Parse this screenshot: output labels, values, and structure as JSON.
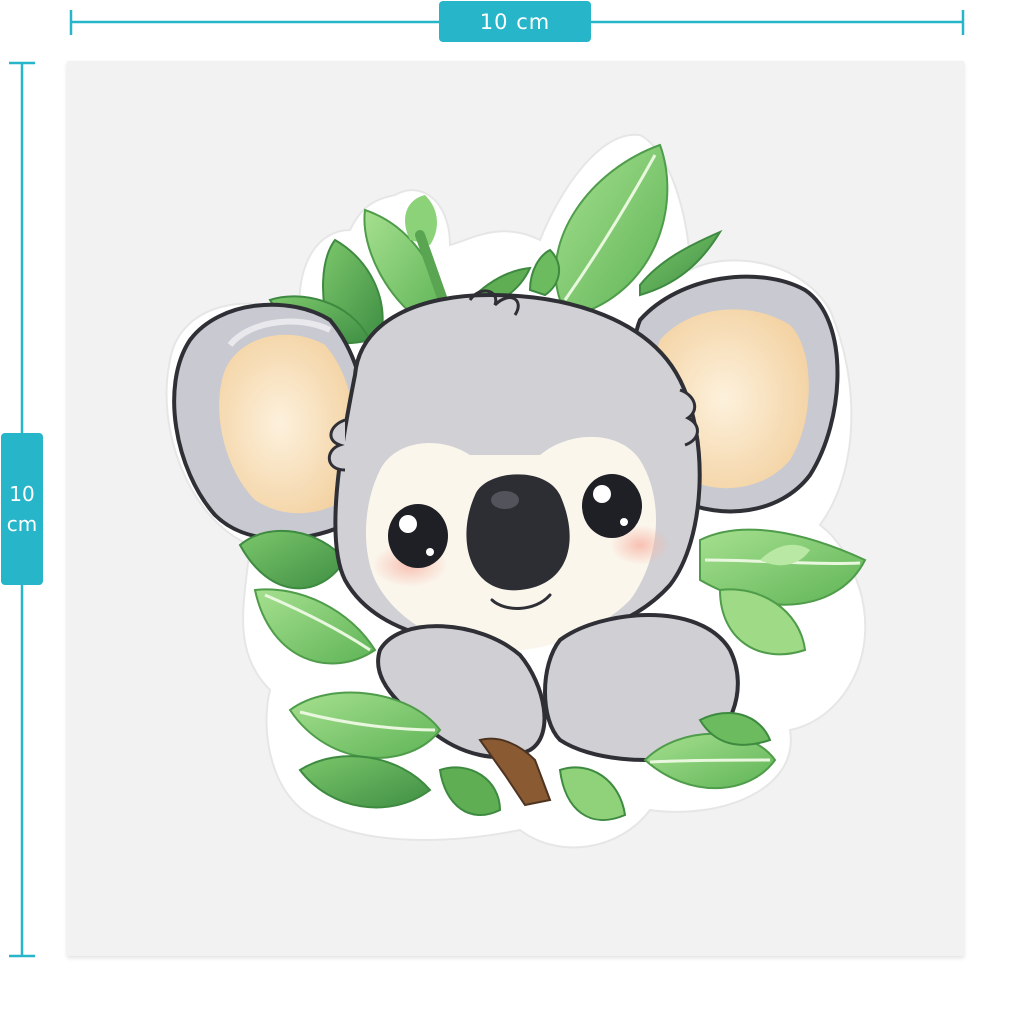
{
  "dimensions": {
    "width_label": "10 cm",
    "height_value": "10",
    "height_unit": "cm"
  },
  "colors": {
    "accent": "#27b6c9",
    "card_background": "#f2f2f2",
    "fur": "#cfcfd4",
    "inner_ear": "#f7dcb0",
    "leaf": "#7cc96a",
    "nose": "#2d2d34"
  },
  "illustration": {
    "subject": "koala-sticker",
    "icons": [
      "koala-icon",
      "leaf-icon",
      "branch-icon"
    ]
  }
}
